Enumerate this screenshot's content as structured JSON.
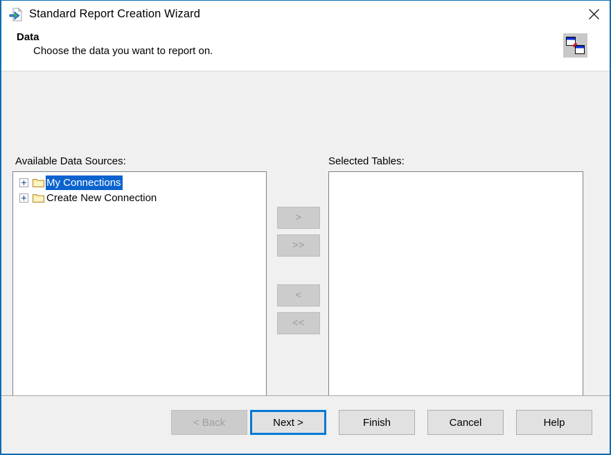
{
  "window": {
    "title": "Standard Report Creation Wizard",
    "title_icon": "report-document-icon",
    "close_icon": "close-icon",
    "border_color": "#0a6bb5"
  },
  "header": {
    "title": "Data",
    "subtitle": "Choose the data you want to report on.",
    "logo_icon": "linked-tables-icon"
  },
  "main": {
    "available_label": "Available Data Sources:",
    "selected_label": "Selected Tables:",
    "available_tree": [
      {
        "label": "My Connections",
        "expander": "plus",
        "icon": "folder-icon",
        "selected": true
      },
      {
        "label": "Create New Connection",
        "expander": "plus",
        "icon": "folder-icon",
        "selected": false
      }
    ],
    "selected_tables": [],
    "selection_color": "#0b63ce",
    "transfer_buttons": [
      {
        "label": ">",
        "name": "move-right-button",
        "disabled": true
      },
      {
        "label": ">>",
        "name": "move-all-right-button",
        "disabled": true
      },
      {
        "label": "<",
        "name": "move-left-button",
        "disabled": true
      },
      {
        "label": "<<",
        "name": "move-all-left-button",
        "disabled": true
      }
    ]
  },
  "footer": {
    "back": "< Back",
    "next": "Next >",
    "finish": "Finish",
    "cancel": "Cancel",
    "help": "Help"
  }
}
